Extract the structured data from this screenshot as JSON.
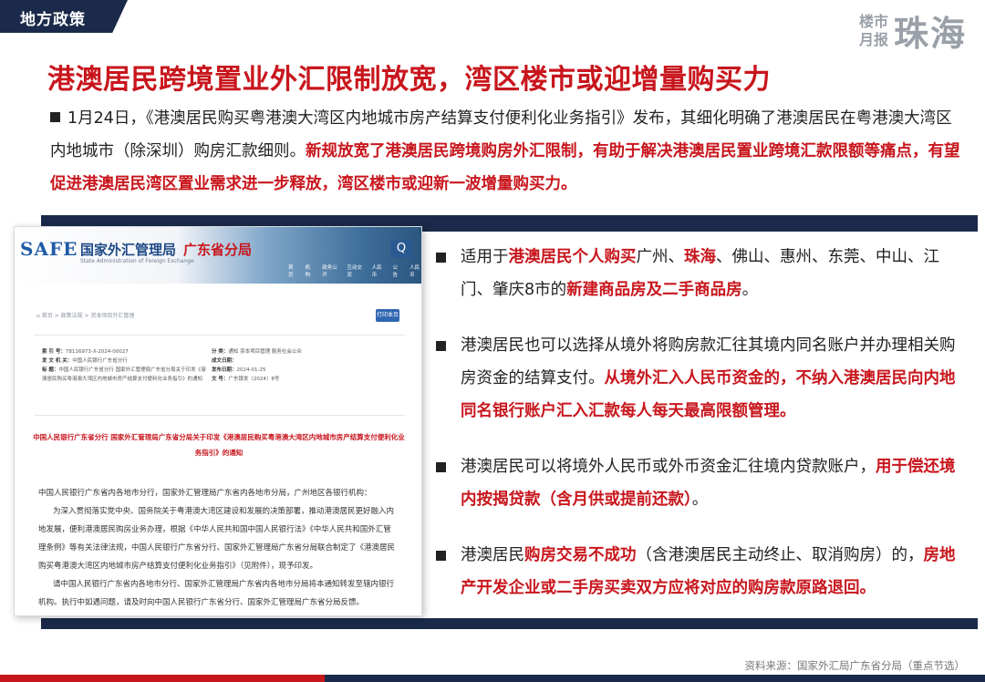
{
  "header": {
    "section_tag": "地方政策",
    "brand_line1": "楼市",
    "brand_line2": "月报",
    "brand_city": "珠海"
  },
  "title": "港澳居民跨境置业外汇限制放宽，湾区楼市或迎增量购买力",
  "intro": {
    "normal": "1月24日，《港澳居民购买粤港澳大湾区内地城市房产结算支付便利化业务指引》发布，其细化明确了港澳居民在粤港澳大湾区内地城市（除深圳）购房汇款细则。",
    "highlight": "新规放宽了港澳居民跨境购房外汇限制，有助于解决港澳居民置业跨境汇款限额等痛点，有望促进港澳居民湾区置业需求进一步释放，湾区楼市或迎新一波增量购买力。"
  },
  "document": {
    "logo": "SAFE",
    "agency": "国家外汇管理局",
    "agency_en": "State Administration of Foreign Exchange",
    "branch": "广东省分局",
    "search_icon": "Q",
    "nav": [
      "首页",
      "机构",
      "政务公开",
      "互动交流",
      "人民币",
      "公告",
      "人民币"
    ],
    "breadcrumb": "⌂ 首页 > 政策法规 > 资本项目外汇管理",
    "print_label": "打印本页",
    "meta_left": [
      {
        "k": "索 引 号：",
        "v": "78116973-X-2024-00027"
      },
      {
        "k": "发 文 机 关：",
        "v": "中国人民银行广东省分行"
      },
      {
        "k": "标 题：",
        "v": "中国人民银行广东省分行 国家外汇管理局广东省分局关于印发《港澳居民购买粤港澳大湾区内地城市房产结算支付便利化业务指引》的通知"
      }
    ],
    "meta_right": [
      {
        "k": "分 类：",
        "v": "通知 资本项目管理 服务社会公众"
      },
      {
        "k": "成文日期：",
        "v": ""
      },
      {
        "k": "发布日期：",
        "v": "2024-01-25"
      },
      {
        "k": "文 号：",
        "v": "广东银发〔2024〕8号"
      }
    ],
    "heading": "中国人民银行广东省分行 国家外汇管理局广东省分局关于印发《港澳居民购买粤港澳大湾区内地城市房产结算支付便利化业务指引》的通知",
    "body": [
      "中国人民银行广东省内各地市分行，国家外汇管理局广东省内各地市分局，广州地区各银行机构：",
      "为深入贯彻落实党中央、国务院关于粤港澳大湾区建设和发展的决策部署，推动港澳居民更好融入内地发展，便利港澳居民购房业务办理，根据《中华人民共和国中国人民银行法》《中华人民共和国外汇管理条例》等有关法律法规，中国人民银行广东省分行、国家外汇管理局广东省分局联合制定了《港澳居民购买粤港澳大湾区内地城市房产结算支付便利化业务指引》（见附件），现予印发。",
      "请中国人民银行广东省内各地市分行、国家外汇管理局广东省内各地市分局将本通知转发至辖内银行机构。执行中如遇问题，请及时向中国人民银行广东省分行、国家外汇管理局广东省分局反馈。"
    ]
  },
  "points": [
    {
      "segments": [
        {
          "t": "适用于",
          "r": false
        },
        {
          "t": "港澳居民个人购买",
          "r": true
        },
        {
          "t": "广州、",
          "r": false
        },
        {
          "t": "珠海",
          "r": true
        },
        {
          "t": "、佛山、惠州、东莞、中山、江门、肇庆8市的",
          "r": false
        },
        {
          "t": "新建商品房及二手商品房",
          "r": true
        },
        {
          "t": "。",
          "r": false
        }
      ]
    },
    {
      "segments": [
        {
          "t": "港澳居民也可以选择从境外将购房款汇往其境内同名账户并办理相关购房资金的结算支付。",
          "r": false
        },
        {
          "t": "从境外汇入人民币资金的，不纳入港澳居民向内地同名银行账户汇入汇款每人每天最高限额管理。",
          "r": true
        }
      ]
    },
    {
      "segments": [
        {
          "t": "港澳居民可以将境外人民币或外币资金汇往境内贷款账户，",
          "r": false
        },
        {
          "t": "用于偿还境内按揭贷款（含月供或提前还款）",
          "r": true
        },
        {
          "t": "。",
          "r": false
        }
      ]
    },
    {
      "segments": [
        {
          "t": "港澳居民",
          "r": false
        },
        {
          "t": "购房交易不成功",
          "r": true
        },
        {
          "t": "（含港澳居民主动终止、取消购房）的，",
          "r": false
        },
        {
          "t": "房地产开发企业或二手房买卖双方应将对应的购房款原路退回。",
          "r": true
        }
      ]
    }
  ],
  "source": "资料来源：国家外汇局广东省分局（重点节选）",
  "colors": {
    "accent_red": "#c8161d",
    "navy": "#1b2a4a",
    "grey": "#9aa0a8"
  }
}
